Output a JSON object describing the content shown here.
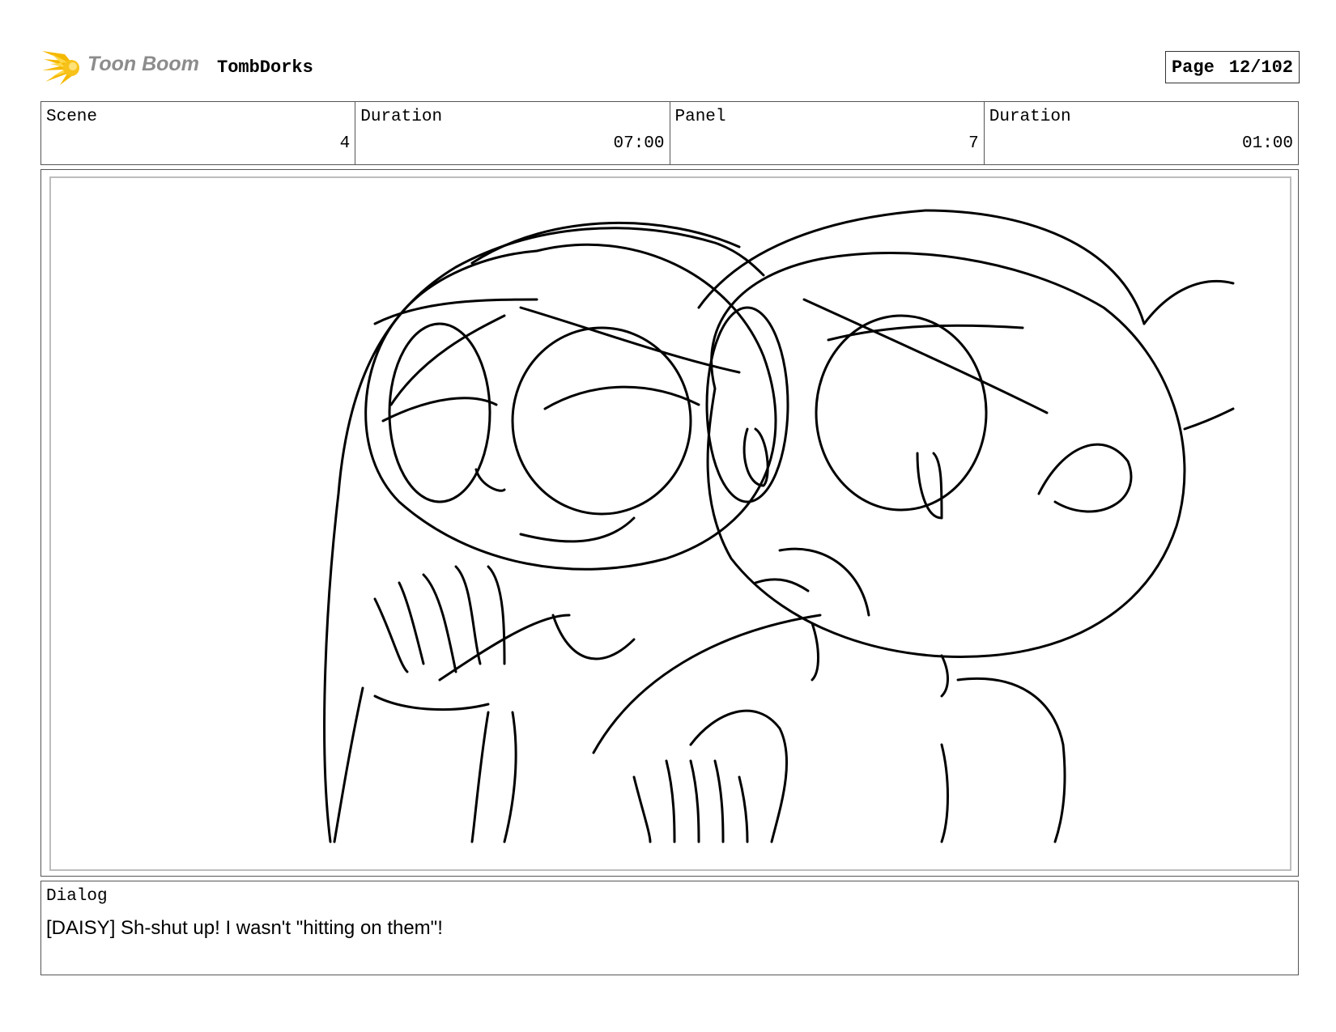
{
  "header": {
    "brand": "Toon Boom",
    "project_title": "TombDorks",
    "page_label": "Page",
    "page_value": "12/102"
  },
  "info": {
    "scene_label": "Scene",
    "scene_value": "4",
    "scene_duration_label": "Duration",
    "scene_duration_value": "07:00",
    "panel_label": "Panel",
    "panel_value": "7",
    "panel_duration_label": "Duration",
    "panel_duration_value": "01:00"
  },
  "dialog": {
    "label": "Dialog",
    "text": "[DAISY] Sh-shut up! I wasn't \"hitting on them\"!"
  },
  "colors": {
    "logo_accent": "#f5b800",
    "border": "#555555",
    "frame": "#bdbdbd"
  }
}
